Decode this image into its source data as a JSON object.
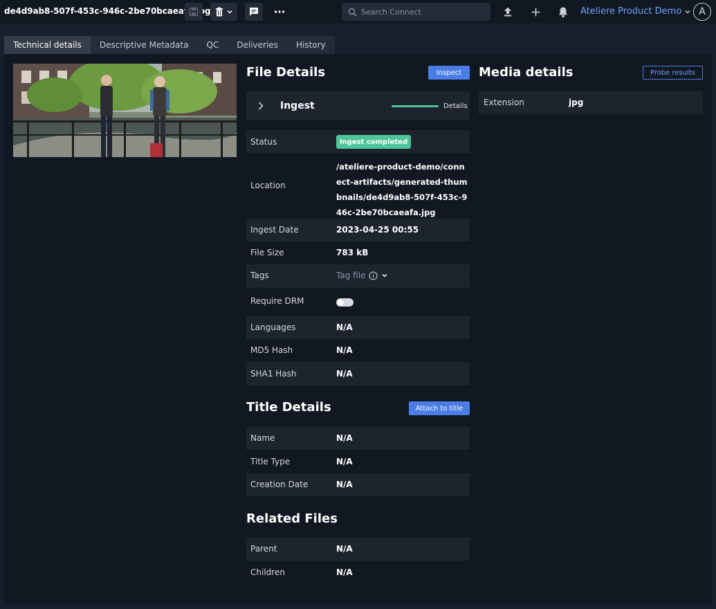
{
  "header": {
    "filename": "de4d9ab8-507f-453c-946c-2be70bcaeafa.jpg",
    "search_placeholder": "Search Connect",
    "org_name": "Ateliere Product Demo",
    "avatar_initial": "A",
    "icons": [
      "save-icon",
      "trash-icon",
      "chevron-down-icon",
      "comment-icon",
      "more-icon",
      "search-icon",
      "upload-icon",
      "plus-icon",
      "bell-icon"
    ]
  },
  "tabs": [
    {
      "label": "Technical details",
      "active": true
    },
    {
      "label": "Descriptive Metadata",
      "active": false
    },
    {
      "label": "QC",
      "active": false
    },
    {
      "label": "Deliveries",
      "active": false
    },
    {
      "label": "History",
      "active": false
    }
  ],
  "file_details": {
    "title": "File Details",
    "inspect_label": "Inspect",
    "ingest": {
      "label": "Ingest",
      "progress": 1.0,
      "details_label": "Details"
    },
    "status": {
      "label": "Status",
      "value": "Ingest completed"
    },
    "location": {
      "label": "Location",
      "value": "/ateliere-product-demo/connect-artifacts/generated-thumbnails/de4d9ab8-507f-453c-946c-2be70bcaeafa.jpg"
    },
    "ingest_date": {
      "label": "Ingest Date",
      "value": "2023-04-25 00:55"
    },
    "file_size": {
      "label": "File Size",
      "value": "783 kB"
    },
    "tags": {
      "label": "Tags",
      "placeholder": "Tag file"
    },
    "require_drm": {
      "label": "Require DRM",
      "enabled": false
    },
    "languages": {
      "label": "Languages",
      "value": "N/A"
    },
    "md5": {
      "label": "MD5 Hash",
      "value": "N/A"
    },
    "sha1": {
      "label": "SHA1 Hash",
      "value": "N/A"
    }
  },
  "title_details": {
    "title": "Title Details",
    "attach_label": "Attach to title",
    "name": {
      "label": "Name",
      "value": "N/A"
    },
    "title_type": {
      "label": "Title Type",
      "value": "N/A"
    },
    "creation_date": {
      "label": "Creation Date",
      "value": "N/A"
    }
  },
  "related_files": {
    "title": "Related Files",
    "parent": {
      "label": "Parent",
      "value": "N/A"
    },
    "children": {
      "label": "Children",
      "value": "N/A"
    }
  },
  "media_details": {
    "title": "Media details",
    "probe_label": "Probe results",
    "extension": {
      "label": "Extension",
      "value": "jpg"
    }
  },
  "colors": {
    "accent": "#4a7de6",
    "success": "#4fc59a",
    "link": "#6ea2ff"
  }
}
